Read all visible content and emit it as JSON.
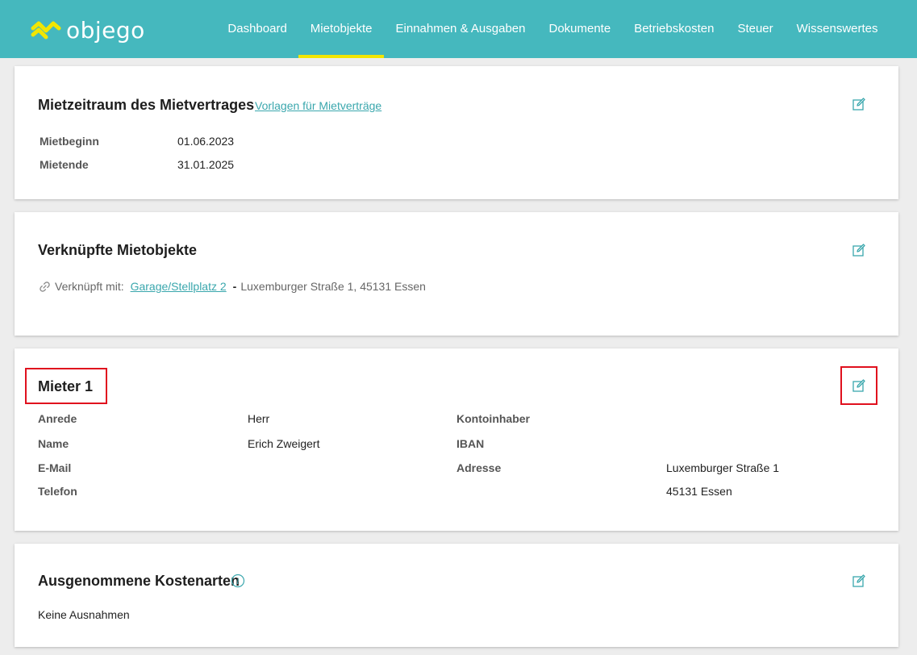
{
  "header": {
    "logo_text": "objego",
    "nav": [
      {
        "label": "Dashboard"
      },
      {
        "label": "Mietobjekte",
        "active": true
      },
      {
        "label": "Einnahmen & Ausgaben"
      },
      {
        "label": "Dokumente"
      },
      {
        "label": "Betriebskosten"
      },
      {
        "label": "Steuer"
      },
      {
        "label": "Wissenswertes"
      }
    ],
    "colors": {
      "bar": "#45b8be",
      "active_underline": "#f2e600",
      "logo_mark": "#f2e600"
    }
  },
  "mietzeitraum": {
    "title": "Mietzeitraum des Mietvertrages",
    "link": "Vorlagen für Mietverträge",
    "rows": [
      {
        "label": "Mietbeginn",
        "value": "01.06.2023"
      },
      {
        "label": "Mietende",
        "value": "31.01.2025"
      }
    ]
  },
  "verknuepft": {
    "title": "Verknüpfte Mietobjekte",
    "prefix": "Verknüpft mit:",
    "link": "Garage/Stellplatz 2",
    "separator": "-",
    "address": "Luxemburger Straße 1, 45131 Essen"
  },
  "mieter": {
    "title": "Mieter 1",
    "left": [
      {
        "label": "Anrede",
        "value": "Herr"
      },
      {
        "label": "Name",
        "value": "Erich Zweigert"
      },
      {
        "label": "E-Mail",
        "value": ""
      },
      {
        "label": "Telefon",
        "value": ""
      }
    ],
    "right": [
      {
        "label": "Kontoinhaber",
        "value": ""
      },
      {
        "label": "IBAN",
        "value": ""
      },
      {
        "label": "Adresse",
        "value": "Luxemburger Straße 1"
      },
      {
        "label": "",
        "value": "45131 Essen"
      }
    ],
    "highlight_color": "#e0101e"
  },
  "kostenarten": {
    "title": "Ausgenommene Kostenarten",
    "text": "Keine Ausnahmen"
  },
  "icons": {
    "edit": "edit-icon",
    "info": "info-icon",
    "link": "link-icon"
  },
  "accent": "#3aa7ad"
}
